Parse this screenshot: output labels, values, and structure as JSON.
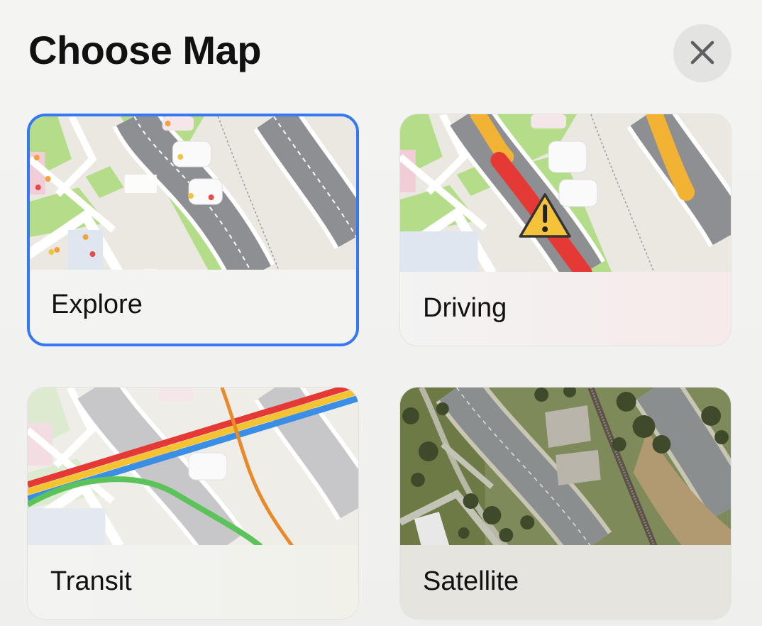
{
  "header": {
    "title": "Choose Map",
    "close_icon": "xmark-icon"
  },
  "map_types": [
    {
      "label": "Explore",
      "selected": true
    },
    {
      "label": "Driving",
      "selected": false
    },
    {
      "label": "Transit",
      "selected": false
    },
    {
      "label": "Satellite",
      "selected": false
    }
  ],
  "colors": {
    "accent": "#3478f6",
    "park": "#b4dd8a",
    "road": "#8e8f93",
    "traffic_heavy": "#e53935",
    "traffic_moderate": "#f2b233",
    "transit_red": "#e53935",
    "transit_yellow": "#f4c430",
    "transit_blue": "#3b8ee6",
    "transit_green": "#5cc35a",
    "transit_orange": "#e88a2a"
  }
}
